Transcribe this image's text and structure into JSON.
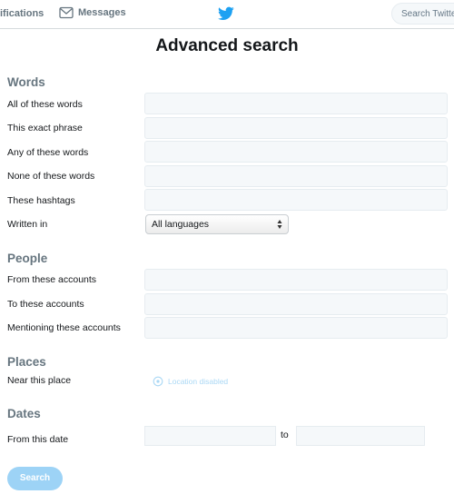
{
  "topbar": {
    "notifications_label": "ifications",
    "messages_label": "Messages",
    "search_placeholder": "Search Twitter"
  },
  "page": {
    "title": "Advanced search"
  },
  "words": {
    "heading": "Words",
    "all_label": "All of these words",
    "exact_label": "This exact phrase",
    "any_label": "Any of these words",
    "none_label": "None of these words",
    "hashtags_label": "These hashtags",
    "language_label": "Written in",
    "language_value": "All languages"
  },
  "people": {
    "heading": "People",
    "from_label": "From these accounts",
    "to_label": "To these accounts",
    "mentioning_label": "Mentioning these accounts"
  },
  "places": {
    "heading": "Places",
    "near_label": "Near this place",
    "location_status": "Location disabled"
  },
  "dates": {
    "heading": "Dates",
    "from_label": "From this date",
    "to_label": "to"
  },
  "actions": {
    "search_label": "Search"
  },
  "colors": {
    "accent": "#1da1f2",
    "button_disabled": "#9dd3f6",
    "section_heading": "#66757f",
    "field_bg": "#f5f8fa"
  },
  "icons": {
    "messages": "envelope-icon",
    "brand": "twitter-bird-icon",
    "location": "location-pin-icon",
    "select_arrows": "up-down-arrows-icon"
  }
}
